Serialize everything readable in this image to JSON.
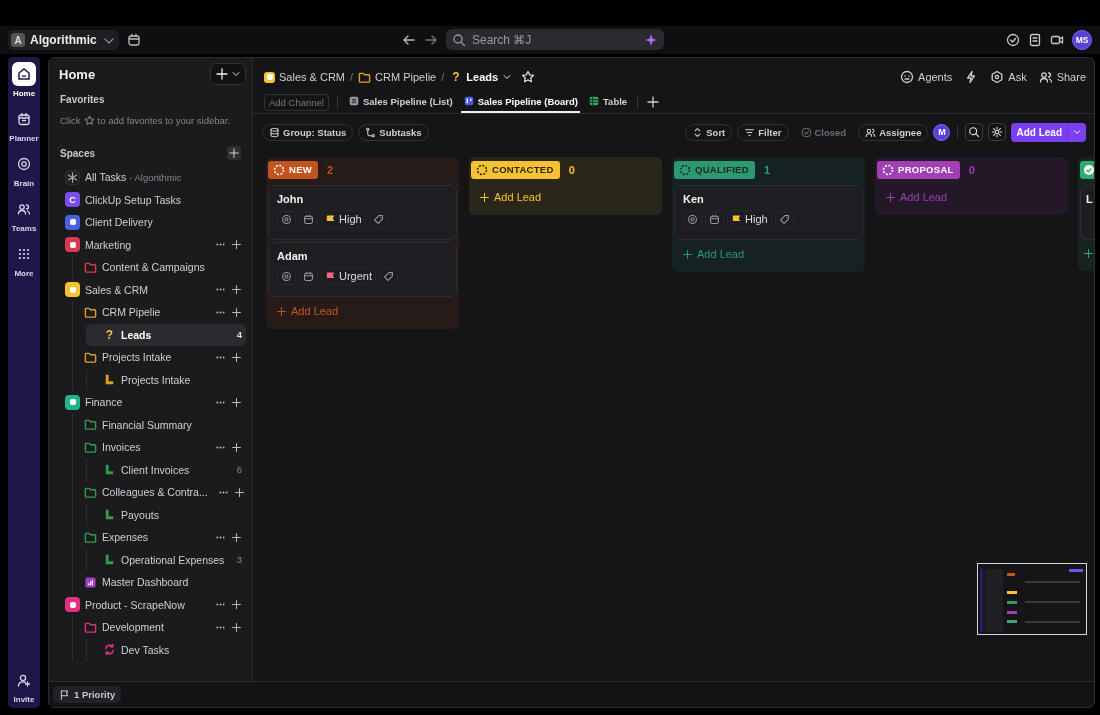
{
  "topbar": {
    "workspace": {
      "initial": "A",
      "name": "Algorithmic"
    },
    "search": {
      "placeholder": "Search ⌘J"
    },
    "avatar": "MS"
  },
  "rail": [
    {
      "label": "Home",
      "selected": true
    },
    {
      "label": "Planner",
      "selected": false
    },
    {
      "label": "Brain",
      "selected": false
    },
    {
      "label": "Teams",
      "selected": false
    },
    {
      "label": "More",
      "selected": false
    }
  ],
  "rail_footer": {
    "label": "Invite"
  },
  "sidebar": {
    "title": "Home",
    "favorites": {
      "heading": "Favorites",
      "hint_before": "Click",
      "hint_after": "to add favorites to your sidebar."
    },
    "spaces_heading": "Spaces",
    "items": [
      {
        "kind": "everything",
        "label": "All Tasks",
        "suffix": "- Algorithmic",
        "selected": false,
        "actions": false
      },
      {
        "kind": "space",
        "label": "ClickUp Setup Tasks",
        "color": "#7b4df0",
        "letter": "C",
        "selected": false,
        "actions": false
      },
      {
        "kind": "space",
        "label": "Client Delivery",
        "color": "#4a62e0",
        "selected": false,
        "actions": false
      },
      {
        "kind": "space",
        "label": "Marketing",
        "color": "#d63a4f",
        "selected": false,
        "actions": true,
        "children": [
          {
            "kind": "folder",
            "label": "Content & Campaigns",
            "color": "#d63a4f",
            "selected": false,
            "actions": false
          }
        ]
      },
      {
        "kind": "space",
        "label": "Sales & CRM",
        "color": "#f5c331",
        "selected": false,
        "actions": true,
        "children": [
          {
            "kind": "folder",
            "label": "CRM Pipelie",
            "color": "#e0a21c",
            "selected": false,
            "actions": true,
            "children": [
              {
                "kind": "list",
                "label": "Leads",
                "color": "#f5c331",
                "glyph": "?",
                "count": "4",
                "selected": true,
                "actions": false
              }
            ]
          },
          {
            "kind": "folder",
            "label": "Projects Intake",
            "color": "#e0a21c",
            "selected": false,
            "actions": true,
            "children": [
              {
                "kind": "list",
                "label": "Projects Intake",
                "color": "#e0a21c",
                "selected": false,
                "actions": false
              }
            ]
          }
        ]
      },
      {
        "kind": "space",
        "label": "Finance",
        "color": "#22b38a",
        "selected": false,
        "actions": true,
        "children": [
          {
            "kind": "folder",
            "label": "Financial Summary",
            "color": "#2e9e4e",
            "selected": false,
            "actions": false
          },
          {
            "kind": "folder",
            "label": "Invoices",
            "color": "#2e9e4e",
            "selected": false,
            "actions": true,
            "children": [
              {
                "kind": "list",
                "label": "Client Invoices",
                "color": "#2e9e4e",
                "count": "6",
                "selected": false,
                "actions": false
              }
            ]
          },
          {
            "kind": "folder",
            "label": "Colleagues & Contra...",
            "color": "#2e9e4e",
            "selected": false,
            "actions": true,
            "children": [
              {
                "kind": "list",
                "label": "Payouts",
                "color": "#2e9e4e",
                "selected": false,
                "actions": false
              }
            ]
          },
          {
            "kind": "folder",
            "label": "Expenses",
            "color": "#2e9e4e",
            "selected": false,
            "actions": true,
            "children": [
              {
                "kind": "list",
                "label": "Operational Expenses",
                "color": "#2e9e4e",
                "count": "3",
                "selected": false,
                "actions": false
              }
            ]
          },
          {
            "kind": "dashboard",
            "label": "Master Dashboard",
            "color": "#a43fc7",
            "selected": false,
            "actions": false
          }
        ]
      },
      {
        "kind": "space",
        "label": "Product - ScrapeNow",
        "color": "#e0307e",
        "selected": false,
        "actions": true,
        "children": [
          {
            "kind": "folder",
            "label": "Development",
            "color": "#e0307e",
            "selected": false,
            "actions": true,
            "children": [
              {
                "kind": "sprint",
                "label": "Dev Tasks",
                "color": "#e0307e",
                "selected": false,
                "actions": false
              }
            ]
          }
        ]
      }
    ]
  },
  "breadcrumb": [
    {
      "kind": "space",
      "label": "Sales & CRM",
      "color": "#f5c331"
    },
    {
      "separator": "/",
      "kind": "folder",
      "label": "CRM Pipelie",
      "color": "#e0a21c"
    },
    {
      "separator": "/",
      "kind": "list",
      "label": "Leads",
      "color": "#f5c331",
      "glyph": "?"
    }
  ],
  "header_actions": [
    {
      "kind": "agents",
      "label": "Agents"
    },
    {
      "kind": "bolt"
    },
    {
      "kind": "ask",
      "label": "Ask"
    },
    {
      "kind": "share",
      "label": "Share"
    }
  ],
  "view_tabs": {
    "add_channel": "Add Channel",
    "tabs": [
      {
        "label": "Sales Pipeline (List)",
        "kind": "list",
        "selected": false
      },
      {
        "label": "Sales Pipeline (Board)",
        "kind": "board",
        "selected": true
      },
      {
        "label": "Table",
        "kind": "table",
        "selected": false
      }
    ]
  },
  "toolbar": {
    "left": [
      {
        "kind": "group",
        "label": "Group: Status"
      },
      {
        "kind": "subtasks",
        "label": "Subtasks"
      }
    ],
    "right": [
      {
        "kind": "sort",
        "label": "Sort",
        "disabled": false
      },
      {
        "kind": "filter",
        "label": "Filter",
        "disabled": false
      },
      {
        "kind": "closed",
        "label": "Closed",
        "disabled": true
      },
      {
        "kind": "assignee",
        "label": "Assignee",
        "disabled": false
      }
    ],
    "avatar": "M",
    "add_button": "Add Lead"
  },
  "board": {
    "columns": [
      {
        "status": "NEW",
        "count": "2",
        "color": "#c4541f",
        "add_label": "Add Lead",
        "cards": [
          {
            "title": "John",
            "priority": {
              "label": "High",
              "color": "#f5c331"
            }
          },
          {
            "title": "Adam",
            "priority": {
              "label": "Urgent",
              "color": "#f06a7a"
            }
          }
        ]
      },
      {
        "status": "CONTACTED",
        "count": "0",
        "color": "#f5c331",
        "add_label": "Add Lead"
      },
      {
        "status": "QUALIFIED",
        "count": "1",
        "color": "#2a9a72",
        "add_label": "Add Lead",
        "cards": [
          {
            "title": "Ken",
            "priority": {
              "label": "High",
              "color": "#f5c331"
            }
          }
        ]
      },
      {
        "status": "PROPOSAL",
        "count": "0",
        "color": "#a23fb5",
        "add_label": "Add Lead"
      },
      {
        "color": "#2eab6e",
        "done": true,
        "cards": [
          {
            "title": "L"
          }
        ]
      }
    ]
  },
  "status_bar": {
    "label": "1 Priority"
  }
}
